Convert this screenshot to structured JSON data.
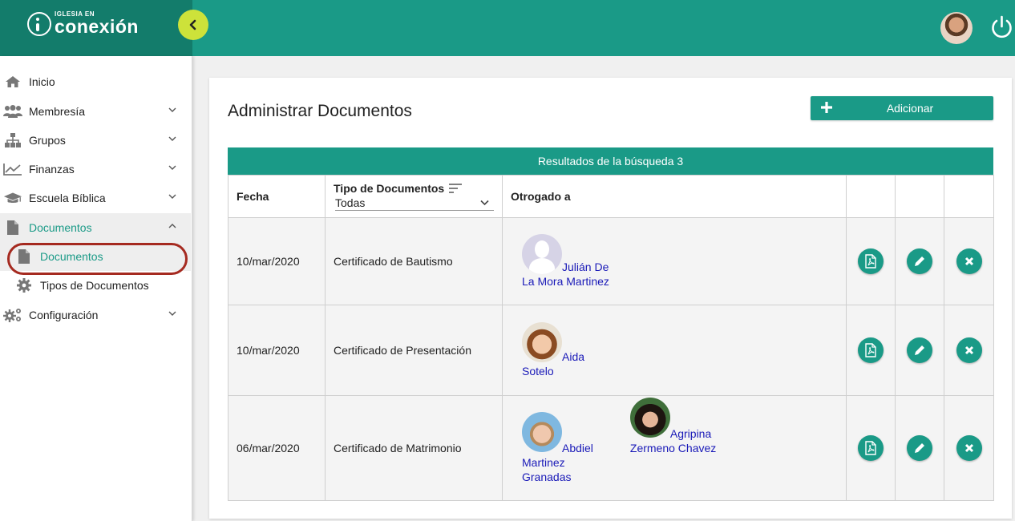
{
  "brand": {
    "logo_small": "IGLESIA EN",
    "logo_big": "conexión"
  },
  "sidebar": {
    "items": [
      {
        "label": "Inicio",
        "icon": "home-icon"
      },
      {
        "label": "Membresía",
        "icon": "users-icon"
      },
      {
        "label": "Grupos",
        "icon": "sitemap-icon"
      },
      {
        "label": "Finanzas",
        "icon": "line-chart-icon"
      },
      {
        "label": "Escuela Bíblica",
        "icon": "graduation-cap-icon"
      },
      {
        "label": "Documentos",
        "icon": "document-icon"
      },
      {
        "label": "Configuración",
        "icon": "gears-icon"
      }
    ],
    "sub_items": [
      {
        "label": "Documentos",
        "icon": "document-icon"
      },
      {
        "label": "Tipos de Documentos",
        "icon": "gear-icon"
      }
    ]
  },
  "main": {
    "title": "Administrar Documentos",
    "add_label": "Adicionar",
    "results_label": "Resultados de la búsqueda 3",
    "columns": {
      "fecha": "Fecha",
      "tipo": "Tipo de Documentos",
      "tipo_filter_value": "Todas",
      "otorgado": "Otrogado a"
    },
    "rows": [
      {
        "fecha": "10/mar/2020",
        "tipo": "Certificado de Bautismo",
        "people": [
          {
            "name_line1": "Julián De",
            "name_line2": "La Mora Martinez",
            "name_line3": ""
          }
        ]
      },
      {
        "fecha": "10/mar/2020",
        "tipo": "Certificado de Presentación",
        "people": [
          {
            "name_line1": "Aida",
            "name_line2": "Sotelo",
            "name_line3": ""
          }
        ]
      },
      {
        "fecha": "06/mar/2020",
        "tipo": "Certificado de Matrimonio",
        "people": [
          {
            "name_line1": "Abdiel",
            "name_line2": "Martinez",
            "name_line3": "Granadas"
          },
          {
            "name_line1": "Agripina",
            "name_line2": "Zermeno Chavez",
            "name_line3": ""
          }
        ]
      }
    ]
  },
  "colors": {
    "primary": "#1a9a87",
    "brand_dark": "#137c6b",
    "accent_yellow": "#cde23a",
    "link": "#1a1ab8",
    "highlight_ring": "#a52a20"
  }
}
